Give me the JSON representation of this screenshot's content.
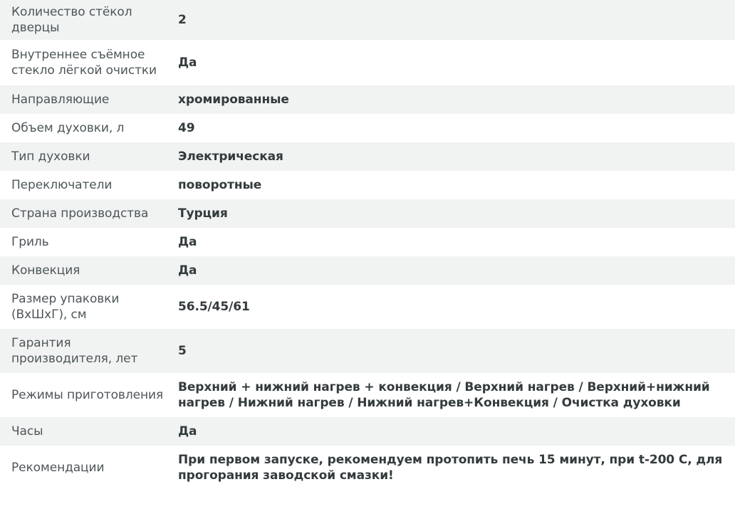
{
  "specs": [
    {
      "label": "Количество стёкол\nдверцы",
      "value": "2"
    },
    {
      "label": "Внутреннее съёмное\nстекло лёгкой очистки",
      "value": "Да"
    },
    {
      "label": "Направляющие",
      "value": "хромированные"
    },
    {
      "label": "Объем духовки, л",
      "value": "49"
    },
    {
      "label": "Тип духовки",
      "value": "Электрическая"
    },
    {
      "label": "Переключатели",
      "value": "поворотные"
    },
    {
      "label": "Страна производства",
      "value": "Турция"
    },
    {
      "label": "Гриль",
      "value": "Да"
    },
    {
      "label": "Конвекция",
      "value": "Да"
    },
    {
      "label": "Размер упаковки\n(ВхШхГ), см",
      "value": "56.5/45/61"
    },
    {
      "label": "Гарантия\nпроизводителя, лет",
      "value": "5"
    },
    {
      "label": "Режимы приготовления",
      "value": "Верхний + нижний нагрев + конвекция / Верхний нагрев / Верхний+нижний нагрев / Нижний нагрев / Нижний нагрев+Конвекция / Очистка духовки"
    },
    {
      "label": "Часы",
      "value": "Да"
    },
    {
      "label": "Рекомендации",
      "value": "При первом запуске, рекомендуем протопить печь 15 минут, при t-200 С, для прогорания заводской смазки!"
    }
  ],
  "colors": {
    "stripe": "#f1f3f3",
    "label_text": "#4d5659",
    "value_text": "#333b3d"
  }
}
